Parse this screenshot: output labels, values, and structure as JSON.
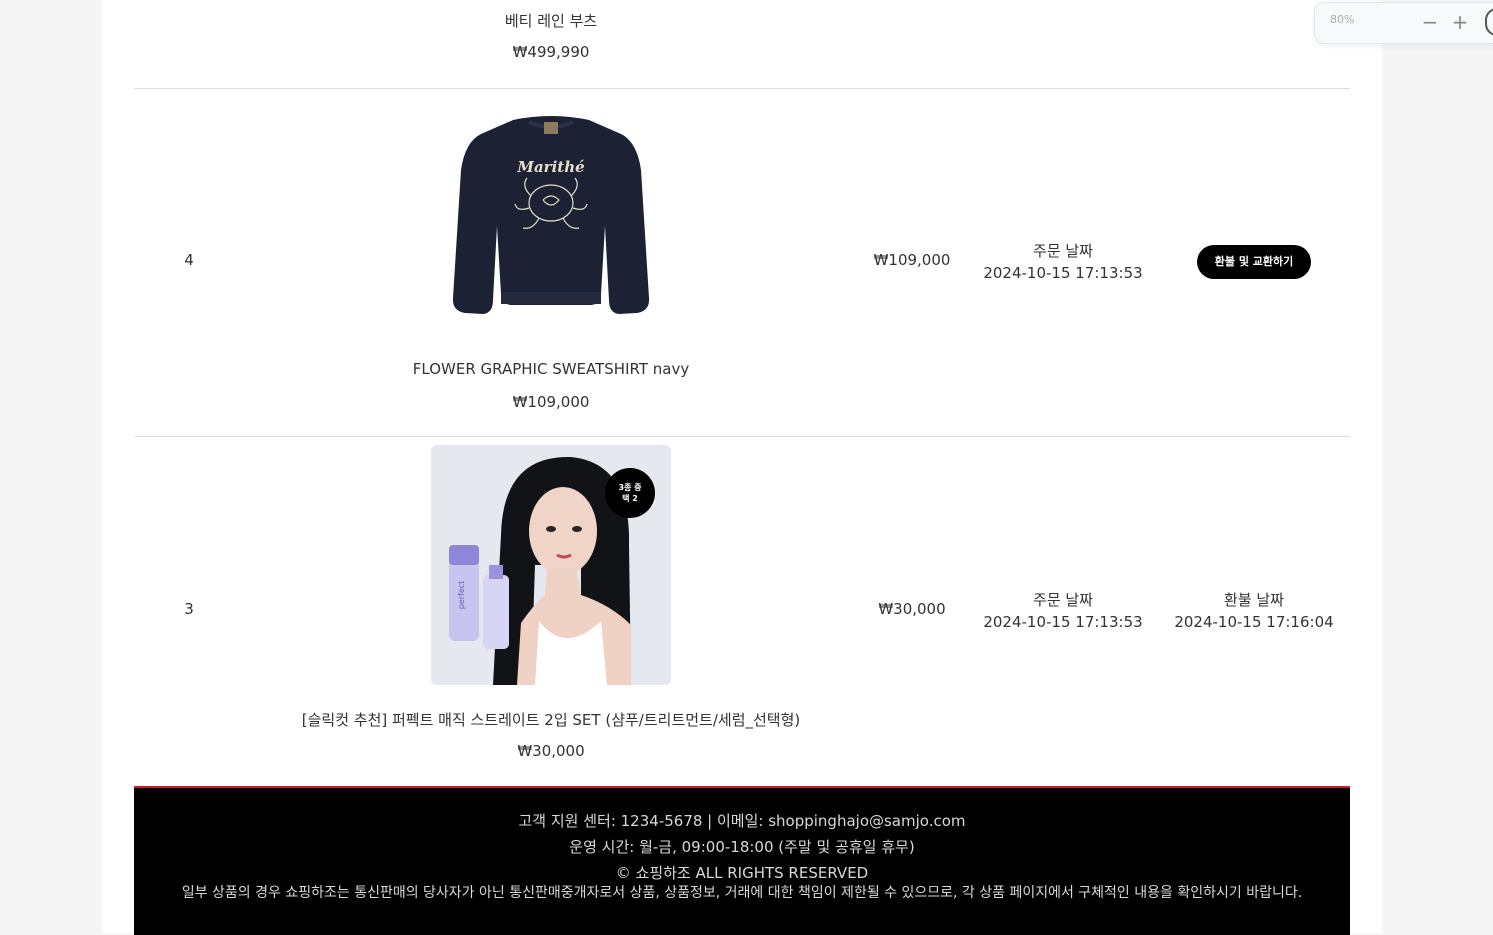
{
  "orders": [
    {
      "product_name": "베티 레인 부츠",
      "product_price": "₩499,990"
    },
    {
      "number": "4",
      "product_name": "FLOWER GRAPHIC SWEATSHIRT navy",
      "product_price": "₩109,000",
      "price": "₩109,000",
      "order_date_label": "주문 날짜",
      "order_date": "2024-10-15 17:13:53",
      "action_label": "환불 및 교환하기",
      "image_text": "Marithé"
    },
    {
      "number": "3",
      "product_name": "[슬릭컷 추천] 퍼펙트 매직 스트레이트 2입 SET (샴푸/트리트먼트/세럼_선택형)",
      "product_price": "₩30,000",
      "price": "₩30,000",
      "order_date_label": "주문 날짜",
      "order_date": "2024-10-15 17:13:53",
      "refund_date_label": "환불 날짜",
      "refund_date": "2024-10-15 17:16:04",
      "badge_line1": "3종 중",
      "badge_line2": "택 2",
      "bottle_text": "perfect"
    }
  ],
  "footer": {
    "support": "고객 지원 센터: 1234-5678 | 이메일: shoppinghajo@samjo.com",
    "hours": "운영 시간: 월-금, 09:00-18:00 (주말 및 공휴일 휴무)",
    "copyright": "© 쇼핑하조 ALL RIGHTS RESERVED",
    "disclaimer": "일부 상품의 경우 쇼핑하조는 통신판매의 당사자가 아닌 통신판매중개자로서 상품, 상품정보, 거래에 대한 책임이 제한될 수 있으므로, 각 상품 페이지에서 구체적인 내용을 확인하시기 바랍니다."
  },
  "zoom": {
    "level": "80%",
    "minus": "−",
    "plus": "+"
  },
  "colors": {
    "footer_bg": "#000000",
    "footer_accent": "#c81e2a",
    "button_bg": "#000000"
  }
}
